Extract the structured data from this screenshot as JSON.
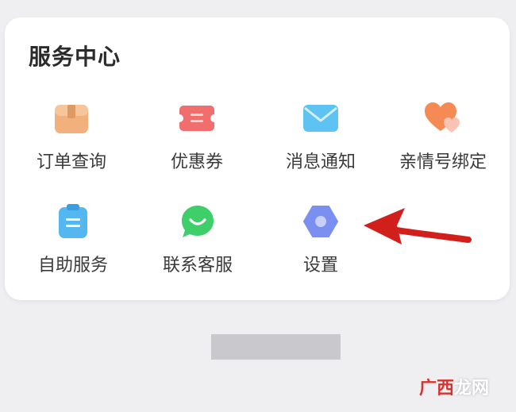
{
  "card": {
    "title": "服务中心"
  },
  "items": [
    {
      "label": "订单查询",
      "icon": "package-icon"
    },
    {
      "label": "优惠券",
      "icon": "coupon-icon"
    },
    {
      "label": "消息通知",
      "icon": "envelope-icon"
    },
    {
      "label": "亲情号绑定",
      "icon": "hearts-icon"
    },
    {
      "label": "自助服务",
      "icon": "clipboard-icon"
    },
    {
      "label": "联系客服",
      "icon": "chat-icon"
    },
    {
      "label": "设置",
      "icon": "hexagon-settings-icon"
    }
  ],
  "watermark": {
    "accent_text": "广西",
    "rest_text": "龙网"
  },
  "colors": {
    "arrow": "#d1201c",
    "page_bg": "#efeff2",
    "card_bg": "#ffffff"
  }
}
